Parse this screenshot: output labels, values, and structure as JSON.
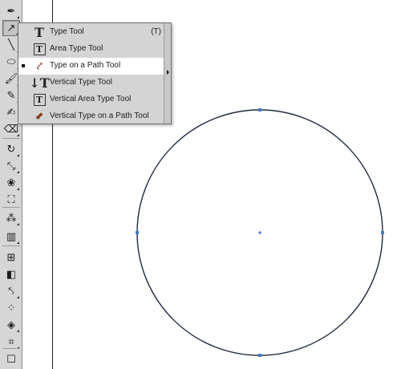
{
  "toolbar": {
    "tools": [
      {
        "icon": "pen-icon",
        "glyph": "✒",
        "has_flyout": true,
        "active": false
      },
      {
        "icon": "type-on-path-icon",
        "glyph": "↗",
        "has_flyout": true,
        "active": true
      },
      {
        "icon": "line-segment-icon",
        "glyph": "╲",
        "has_flyout": true,
        "active": false
      },
      {
        "icon": "ellipse-icon",
        "glyph": "⬭",
        "has_flyout": true,
        "active": false
      },
      {
        "icon": "paintbrush-icon",
        "glyph": "🖌",
        "has_flyout": true,
        "active": false
      },
      {
        "icon": "pencil-icon",
        "glyph": "✎",
        "has_flyout": true,
        "active": false
      },
      {
        "icon": "blob-brush-icon",
        "glyph": "✍",
        "has_flyout": false,
        "active": false
      },
      {
        "icon": "eraser-icon",
        "glyph": "⌫",
        "has_flyout": true,
        "active": false
      },
      {
        "icon": "rotate-icon",
        "glyph": "↻",
        "has_flyout": true,
        "active": false
      },
      {
        "icon": "scale-icon",
        "glyph": "⤡",
        "has_flyout": true,
        "active": false
      },
      {
        "icon": "warp-icon",
        "glyph": "❀",
        "has_flyout": true,
        "active": false
      },
      {
        "icon": "free-transform-icon",
        "glyph": "⛶",
        "has_flyout": false,
        "active": false
      },
      {
        "icon": "symbol-sprayer-icon",
        "glyph": "⁂",
        "has_flyout": true,
        "active": false
      },
      {
        "icon": "column-graph-icon",
        "glyph": "▥",
        "has_flyout": true,
        "active": false
      },
      {
        "icon": "mesh-icon",
        "glyph": "⊞",
        "has_flyout": false,
        "active": false
      },
      {
        "icon": "gradient-icon",
        "glyph": "◧",
        "has_flyout": false,
        "active": false
      },
      {
        "icon": "eyedropper-icon",
        "glyph": "⤣",
        "has_flyout": true,
        "active": false
      },
      {
        "icon": "blend-icon",
        "glyph": "⁘",
        "has_flyout": false,
        "active": false
      },
      {
        "icon": "live-paint-bucket-icon",
        "glyph": "◈",
        "has_flyout": true,
        "active": false
      },
      {
        "icon": "crop-area-icon",
        "glyph": "⌗",
        "has_flyout": true,
        "active": false
      },
      {
        "icon": "artboard-icon",
        "glyph": "☐",
        "has_flyout": false,
        "active": false
      }
    ]
  },
  "flyout": {
    "items": [
      {
        "icon": "type-tool-icon",
        "icon_glyph": "T",
        "icon_style": "big-t",
        "label": "Type Tool",
        "shortcut": "(T)",
        "selected": false
      },
      {
        "icon": "area-type-tool-icon",
        "icon_glyph": "T",
        "icon_style": "boxed-t",
        "label": "Area Type Tool",
        "shortcut": "",
        "selected": false
      },
      {
        "icon": "type-on-path-tool-icon",
        "icon_glyph": "⤤",
        "icon_style": "path",
        "label": "Type on a Path Tool",
        "shortcut": "",
        "selected": true
      },
      {
        "icon": "vertical-type-tool-icon",
        "icon_glyph": "↓T",
        "icon_style": "big-t",
        "label": "Vertical Type Tool",
        "shortcut": "",
        "selected": false
      },
      {
        "icon": "vertical-area-type-tool-icon",
        "icon_glyph": "T",
        "icon_style": "boxed-t",
        "label": "Vertical Area Type Tool",
        "shortcut": "",
        "selected": false
      },
      {
        "icon": "vertical-type-on-path-tool-icon",
        "icon_glyph": "⬋",
        "icon_style": "path",
        "label": "Vertical Type on a Path Tool",
        "shortcut": "",
        "selected": false
      }
    ]
  },
  "artwork": {
    "shape": "circle",
    "stroke_color": "#1f2a44",
    "anchor_color": "#4a78c8"
  }
}
